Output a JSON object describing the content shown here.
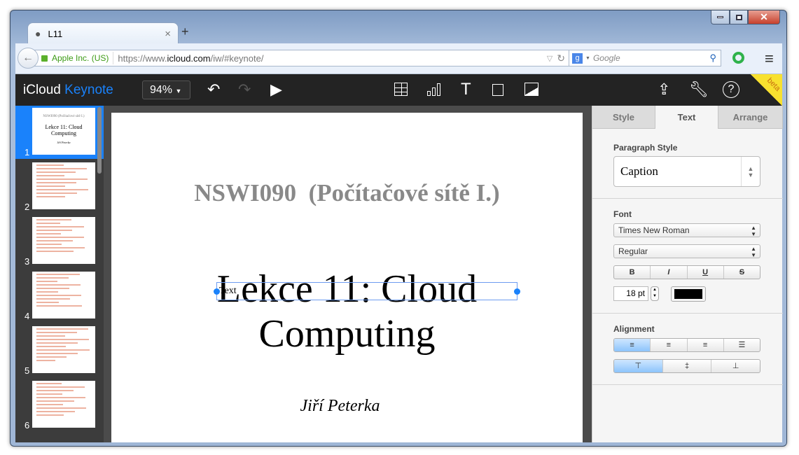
{
  "browser": {
    "tab_title": "L11",
    "new_tab": "+",
    "close_tab": "×",
    "identity": "Apple Inc. (US)",
    "url_prefix": "https://www.",
    "url_domain": "icloud.com",
    "url_path": "/iw/#keynote/",
    "search_placeholder": "Google",
    "window_controls": [
      "minimize",
      "maximize",
      "close"
    ]
  },
  "app": {
    "brand_icloud": "iCloud",
    "brand_keynote": "Keynote",
    "zoom": "94%",
    "beta": "beta",
    "brand_color": "#1a82fb"
  },
  "toolbar": {
    "tools": [
      "table-icon",
      "chart-icon",
      "text-icon",
      "shape-icon",
      "media-icon"
    ],
    "right": [
      "share-icon",
      "wrench-icon",
      "help-icon"
    ]
  },
  "slides": [
    {
      "n": "1",
      "title": "NSWI090 (Počítačové sítě I.)",
      "heading": "Lekce 11: Cloud Computing",
      "author": "Jiří Peterka"
    },
    {
      "n": "2"
    },
    {
      "n": "3"
    },
    {
      "n": "4"
    },
    {
      "n": "5"
    },
    {
      "n": "6"
    }
  ],
  "slide": {
    "subtitle": "NSWI090  (Počítačové sítě I.)",
    "title_line1": "Lekce 11: Cloud",
    "title_line2": "Computing",
    "author": "Jiří Peterka",
    "placeholder": "Text"
  },
  "panel": {
    "tabs": [
      "Style",
      "Text",
      "Arrange"
    ],
    "active_tab": "Text",
    "paragraph_style_label": "Paragraph Style",
    "paragraph_style": "Caption",
    "font_label": "Font",
    "font_family": "Times New Roman",
    "font_style": "Regular",
    "bold": "B",
    "italic": "I",
    "underline": "U",
    "strike": "S",
    "font_size": "18 pt",
    "text_color": "#000000",
    "alignment_label": "Alignment",
    "h_align": "left",
    "v_align": "top"
  }
}
